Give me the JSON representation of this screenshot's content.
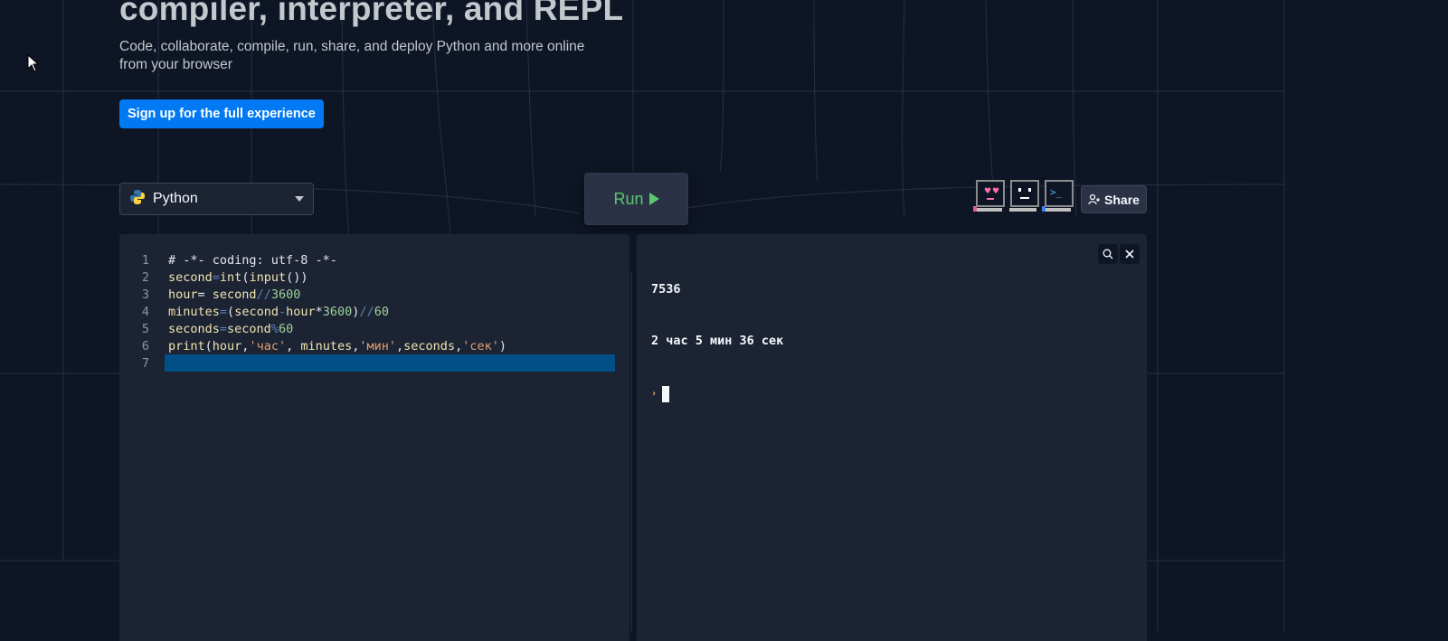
{
  "hero": {
    "title": "compiler, interpreter, and REPL",
    "subtitle": "Code, collaborate, compile, run, share, and deploy Python and more online from your browser",
    "signup_label": "Sign up for the full experience"
  },
  "toolbar": {
    "language": "Python",
    "run_label": "Run",
    "share_label": "Share",
    "avatars": [
      "heart-eyes-computer-icon",
      "neutral-computer-icon",
      "terminal-computer-icon"
    ]
  },
  "editor": {
    "lines": [
      {
        "num": "1",
        "tokens": [
          {
            "t": "# -*- coding: utf-8 -*-",
            "c": "t-kw"
          }
        ]
      },
      {
        "num": "2",
        "tokens": [
          {
            "t": "second",
            "c": "t-var"
          },
          {
            "t": "=",
            "c": "t-op"
          },
          {
            "t": "int",
            "c": "t-fn"
          },
          {
            "t": "(",
            "c": "t-kw"
          },
          {
            "t": "input",
            "c": "t-fn"
          },
          {
            "t": "())",
            "c": "t-kw"
          }
        ]
      },
      {
        "num": "3",
        "tokens": [
          {
            "t": "hour",
            "c": "t-var"
          },
          {
            "t": "= ",
            "c": "t-kw"
          },
          {
            "t": "second",
            "c": "t-var"
          },
          {
            "t": "//",
            "c": "t-op"
          },
          {
            "t": "3600",
            "c": "t-num"
          }
        ]
      },
      {
        "num": "4",
        "tokens": [
          {
            "t": "minutes",
            "c": "t-var"
          },
          {
            "t": "=",
            "c": "t-op"
          },
          {
            "t": "(",
            "c": "t-kw"
          },
          {
            "t": "second",
            "c": "t-var"
          },
          {
            "t": "-",
            "c": "t-op"
          },
          {
            "t": "hour",
            "c": "t-var"
          },
          {
            "t": "*",
            "c": "t-kw"
          },
          {
            "t": "3600",
            "c": "t-num"
          },
          {
            "t": ")",
            "c": "t-kw"
          },
          {
            "t": "//",
            "c": "t-op"
          },
          {
            "t": "60",
            "c": "t-num"
          }
        ]
      },
      {
        "num": "5",
        "tokens": [
          {
            "t": "seconds",
            "c": "t-var"
          },
          {
            "t": "=",
            "c": "t-op"
          },
          {
            "t": "second",
            "c": "t-var"
          },
          {
            "t": "%",
            "c": "t-op"
          },
          {
            "t": "60",
            "c": "t-num"
          }
        ]
      },
      {
        "num": "6",
        "tokens": [
          {
            "t": "print",
            "c": "t-fn"
          },
          {
            "t": "(",
            "c": "t-kw"
          },
          {
            "t": "hour",
            "c": "t-var"
          },
          {
            "t": ",",
            "c": "t-kw"
          },
          {
            "t": "'час'",
            "c": "t-str"
          },
          {
            "t": ", ",
            "c": "t-kw"
          },
          {
            "t": "minutes",
            "c": "t-var"
          },
          {
            "t": ",",
            "c": "t-kw"
          },
          {
            "t": "'мин'",
            "c": "t-str"
          },
          {
            "t": ",",
            "c": "t-kw"
          },
          {
            "t": "seconds",
            "c": "t-var"
          },
          {
            "t": ",",
            "c": "t-kw"
          },
          {
            "t": "'сек'",
            "c": "t-str"
          },
          {
            "t": ")",
            "c": "t-kw"
          }
        ]
      },
      {
        "num": "7",
        "tokens": []
      }
    ]
  },
  "console": {
    "output": [
      "7536",
      "2 час 5 мин 36 сек"
    ],
    "prompt": "›"
  },
  "colors": {
    "background": "#0e1525",
    "panel": "#1c2333",
    "accent": "#0079f2",
    "run_green": "#58c76f"
  }
}
